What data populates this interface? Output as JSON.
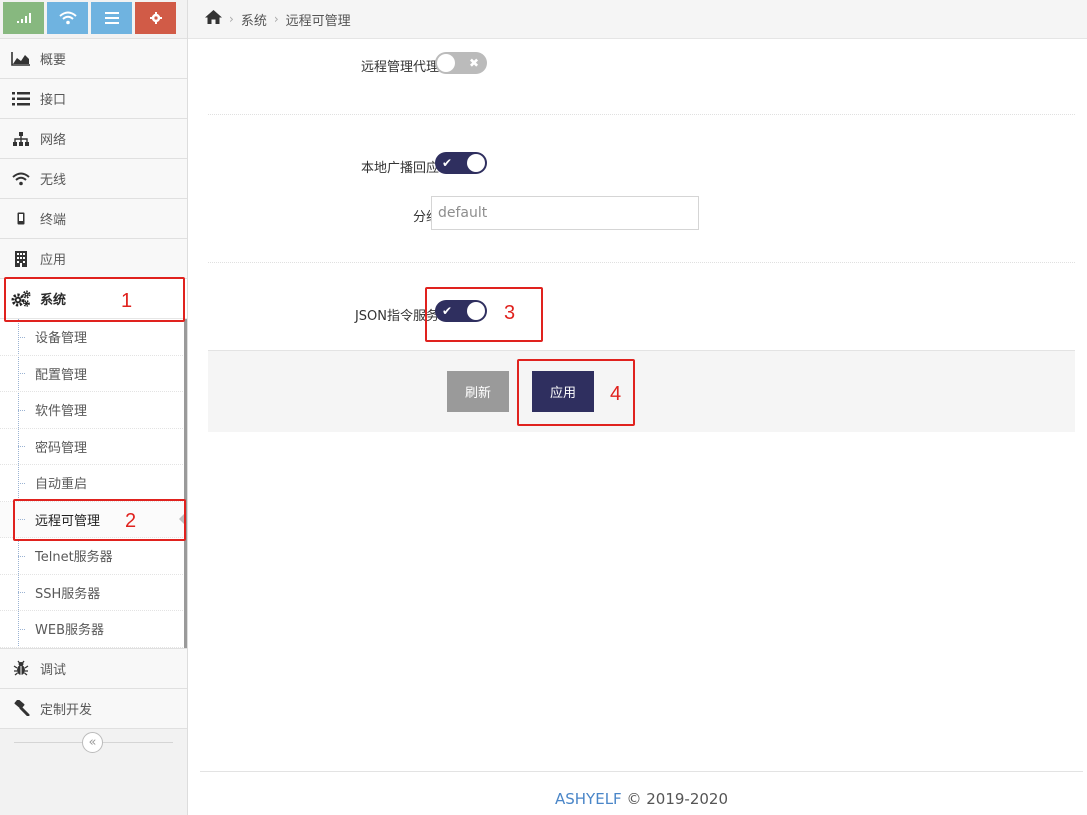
{
  "shortcuts": [
    {
      "name": "signal",
      "color": "#87b87f"
    },
    {
      "name": "wifi",
      "color": "#6fb3e0"
    },
    {
      "name": "list",
      "color": "#6fb3e0"
    },
    {
      "name": "settings",
      "color": "#d15b47"
    }
  ],
  "nav": {
    "overview": "概要",
    "interface": "接口",
    "network": "网络",
    "wireless": "无线",
    "terminal": "终端",
    "application": "应用",
    "system": "系统",
    "debug": "调试",
    "custom_dev": "定制开发"
  },
  "system_submenu": [
    "设备管理",
    "配置管理",
    "软件管理",
    "密码管理",
    "自动重启",
    "远程可管理",
    "Telnet服务器",
    "SSH服务器",
    "WEB服务器"
  ],
  "breadcrumb": {
    "level1": "系统",
    "level2": "远程可管理"
  },
  "form": {
    "remote_proxy_label": "远程管理代理",
    "remote_proxy_enabled": false,
    "local_broadcast_label": "本地广播回应",
    "local_broadcast_enabled": true,
    "group_label": "分组",
    "group_placeholder": "default",
    "json_service_label": "JSON指令服务",
    "json_service_enabled": true
  },
  "buttons": {
    "refresh": "刷新",
    "apply": "应用"
  },
  "annotations": [
    "1",
    "2",
    "3",
    "4"
  ],
  "footer": {
    "brand": "ASHYELF",
    "copyright": "© 2019-2020"
  },
  "colors": {
    "accent": "#2f2f5f",
    "annotation": "#e0221e",
    "brand": "#4a86c8"
  }
}
